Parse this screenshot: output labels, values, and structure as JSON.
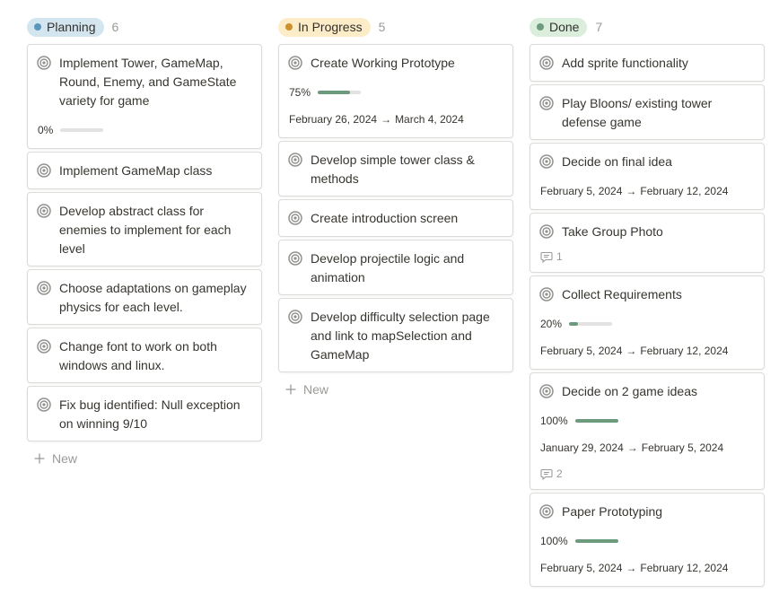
{
  "colors": {
    "planning_pill": "#d3e5ef",
    "planning_dot": "#5b97bd",
    "progress_pill": "#fdecc8",
    "progress_dot": "#cb912f",
    "done_pill": "#dbeddb",
    "done_dot": "#6c9b7d",
    "progress_bar": "#6b9a7c"
  },
  "columns": [
    {
      "name": "Planning",
      "count": "6",
      "new_label": "New",
      "cards": [
        {
          "title": "Implement Tower, GameMap, Round, Enemy, and GameState variety for game",
          "progress_text": "0%",
          "progress": 0
        },
        {
          "title": "Implement GameMap class"
        },
        {
          "title": "Develop abstract class for enemies to implement for each level"
        },
        {
          "title": "Choose adaptations on gameplay physics for each level."
        },
        {
          "title": "Change font to work on both windows and linux."
        },
        {
          "title": "Fix bug identified: Null exception on winning 9/10"
        }
      ]
    },
    {
      "name": "In Progress",
      "count": "5",
      "new_label": "New",
      "cards": [
        {
          "title": "Create Working Prototype",
          "progress_text": "75%",
          "progress": 0.75,
          "date_start": "February 26, 2024",
          "date_end": "March 4, 2024"
        },
        {
          "title": "Develop simple tower class & methods"
        },
        {
          "title": "Create introduction screen"
        },
        {
          "title": "Develop projectile logic and animation"
        },
        {
          "title": "Develop difficulty selection page and link to mapSelection and GameMap"
        }
      ]
    },
    {
      "name": "Done",
      "count": "7",
      "cards": [
        {
          "title": "Add sprite functionality"
        },
        {
          "title": "Play Bloons/ existing tower defense game"
        },
        {
          "title": "Decide on final idea",
          "date_start": "February 5, 2024",
          "date_end": "February 12, 2024"
        },
        {
          "title": "Take Group Photo",
          "comments": "1"
        },
        {
          "title": "Collect Requirements",
          "progress_text": "20%",
          "progress": 0.2,
          "date_start": "February 5, 2024",
          "date_end": "February 12, 2024"
        },
        {
          "title": "Decide on 2 game ideas",
          "progress_text": "100%",
          "progress": 1,
          "date_start": "January 29, 2024",
          "date_end": "February 5, 2024",
          "comments": "2"
        },
        {
          "title": "Paper Prototyping",
          "progress_text": "100%",
          "progress": 1,
          "date_start": "February 5, 2024",
          "date_end": "February 12, 2024"
        }
      ]
    }
  ],
  "date_arrow": "→",
  "icons": {
    "card_icon": "target-icon",
    "comment_icon": "comment-icon",
    "new_icon": "plus-icon"
  }
}
